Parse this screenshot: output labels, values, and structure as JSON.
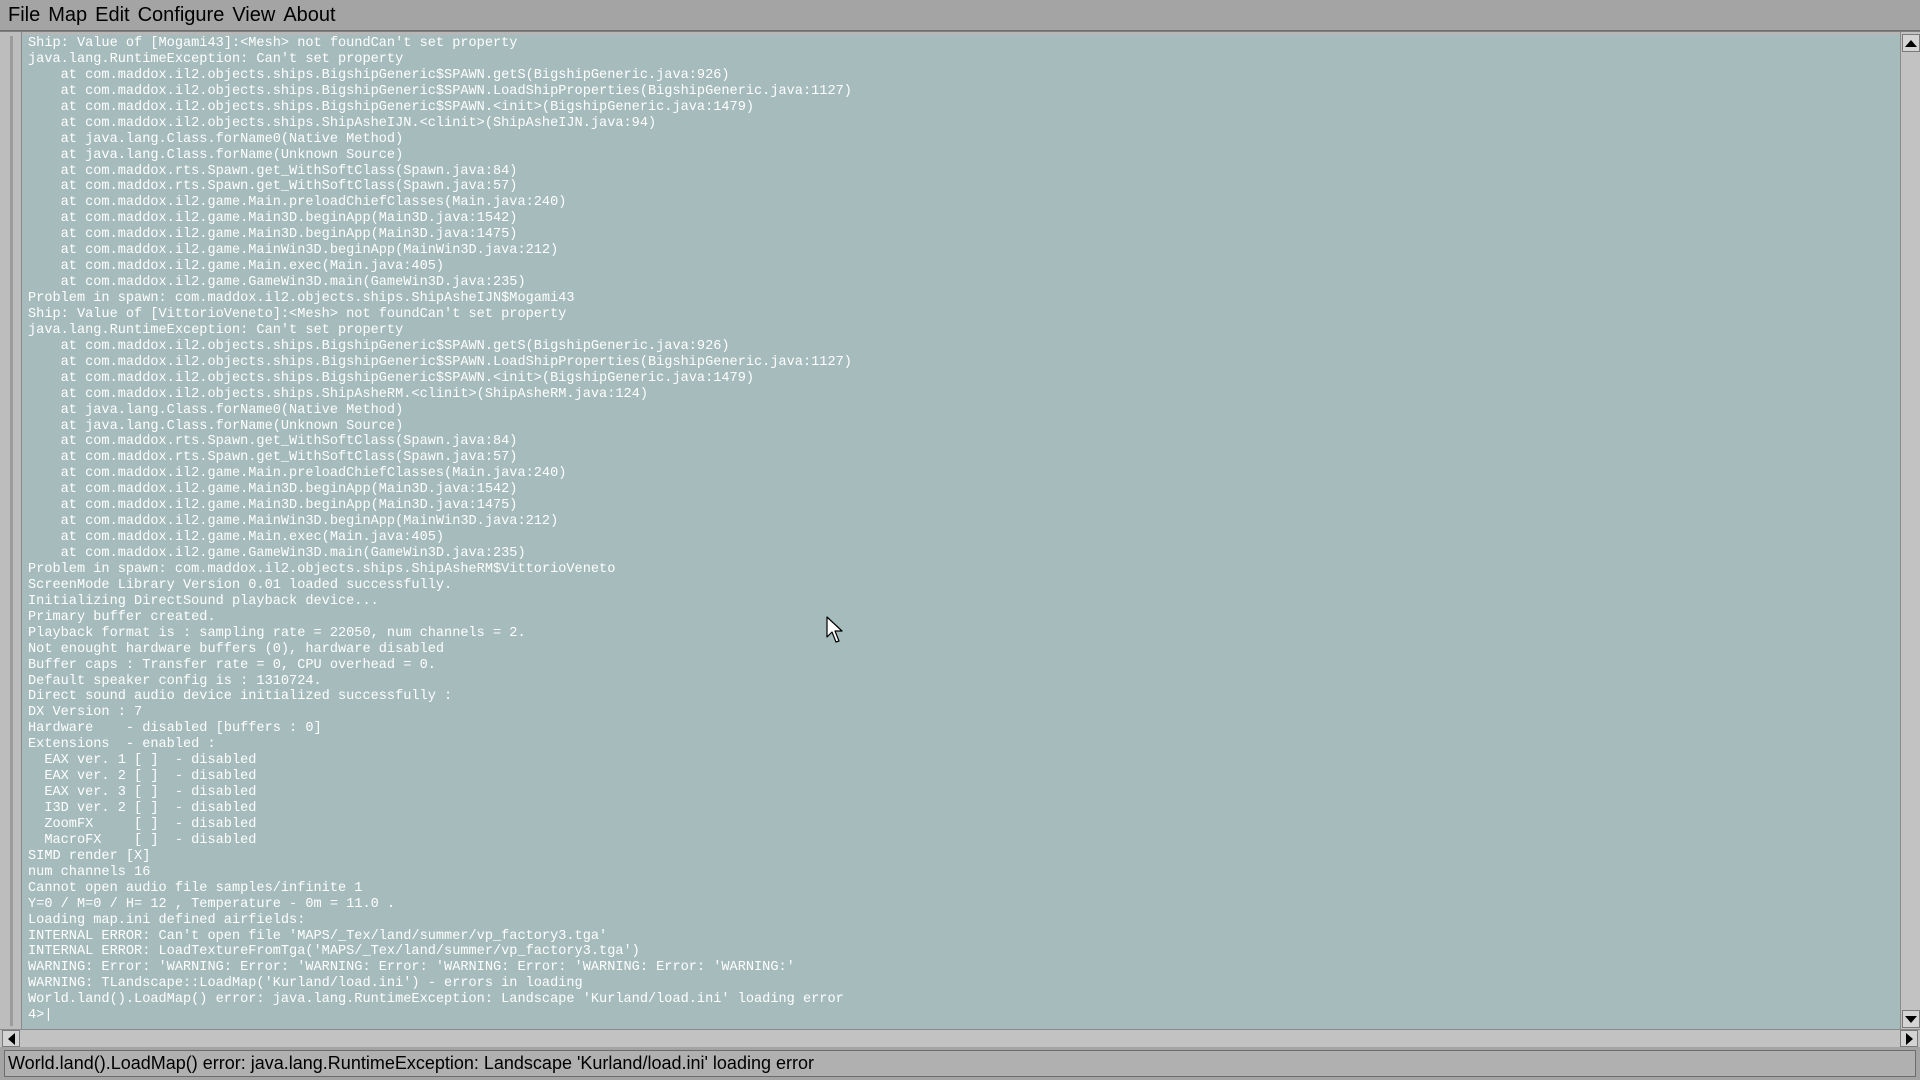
{
  "menubar": {
    "items": [
      "File",
      "Map",
      "Edit",
      "Configure",
      "View",
      "About"
    ]
  },
  "console": {
    "lines": [
      "Ship: Value of [Mogami43]:<Mesh> not foundCan't set property",
      "java.lang.RuntimeException: Can't set property",
      "    at com.maddox.il2.objects.ships.BigshipGeneric$SPAWN.getS(BigshipGeneric.java:926)",
      "    at com.maddox.il2.objects.ships.BigshipGeneric$SPAWN.LoadShipProperties(BigshipGeneric.java:1127)",
      "    at com.maddox.il2.objects.ships.BigshipGeneric$SPAWN.<init>(BigshipGeneric.java:1479)",
      "    at com.maddox.il2.objects.ships.ShipAsheIJN.<clinit>(ShipAsheIJN.java:94)",
      "    at java.lang.Class.forName0(Native Method)",
      "    at java.lang.Class.forName(Unknown Source)",
      "    at com.maddox.rts.Spawn.get_WithSoftClass(Spawn.java:84)",
      "    at com.maddox.rts.Spawn.get_WithSoftClass(Spawn.java:57)",
      "    at com.maddox.il2.game.Main.preloadChiefClasses(Main.java:240)",
      "    at com.maddox.il2.game.Main3D.beginApp(Main3D.java:1542)",
      "    at com.maddox.il2.game.Main3D.beginApp(Main3D.java:1475)",
      "    at com.maddox.il2.game.MainWin3D.beginApp(MainWin3D.java:212)",
      "    at com.maddox.il2.game.Main.exec(Main.java:405)",
      "    at com.maddox.il2.game.GameWin3D.main(GameWin3D.java:235)",
      "Problem in spawn: com.maddox.il2.objects.ships.ShipAsheIJN$Mogami43",
      "Ship: Value of [VittorioVeneto]:<Mesh> not foundCan't set property",
      "java.lang.RuntimeException: Can't set property",
      "    at com.maddox.il2.objects.ships.BigshipGeneric$SPAWN.getS(BigshipGeneric.java:926)",
      "    at com.maddox.il2.objects.ships.BigshipGeneric$SPAWN.LoadShipProperties(BigshipGeneric.java:1127)",
      "    at com.maddox.il2.objects.ships.BigshipGeneric$SPAWN.<init>(BigshipGeneric.java:1479)",
      "    at com.maddox.il2.objects.ships.ShipAsheRM.<clinit>(ShipAsheRM.java:124)",
      "    at java.lang.Class.forName0(Native Method)",
      "    at java.lang.Class.forName(Unknown Source)",
      "    at com.maddox.rts.Spawn.get_WithSoftClass(Spawn.java:84)",
      "    at com.maddox.rts.Spawn.get_WithSoftClass(Spawn.java:57)",
      "    at com.maddox.il2.game.Main.preloadChiefClasses(Main.java:240)",
      "    at com.maddox.il2.game.Main3D.beginApp(Main3D.java:1542)",
      "    at com.maddox.il2.game.Main3D.beginApp(Main3D.java:1475)",
      "    at com.maddox.il2.game.MainWin3D.beginApp(MainWin3D.java:212)",
      "    at com.maddox.il2.game.Main.exec(Main.java:405)",
      "    at com.maddox.il2.game.GameWin3D.main(GameWin3D.java:235)",
      "Problem in spawn: com.maddox.il2.objects.ships.ShipAsheRM$VittorioVeneto",
      "ScreenMode Library Version 0.01 loaded successfully.",
      "Initializing DirectSound playback device...",
      "Primary buffer created.",
      "Playback format is : sampling rate = 22050, num channels = 2.",
      "Not enought hardware buffers (0), hardware disabled",
      "Buffer caps : Transfer rate = 0, CPU overhead = 0.",
      "Default speaker config is : 1310724.",
      "Direct sound audio device initialized successfully :",
      "DX Version : 7",
      "Hardware    - disabled [buffers : 0]",
      "Extensions  - enabled :",
      "  EAX ver. 1 [ ]  - disabled",
      "  EAX ver. 2 [ ]  - disabled",
      "  EAX ver. 3 [ ]  - disabled",
      "  I3D ver. 2 [ ]  - disabled",
      "  ZoomFX     [ ]  - disabled",
      "  MacroFX    [ ]  - disabled",
      "SIMD render [X]",
      "num channels 16",
      "Cannot open audio file samples/infinite 1",
      "Y=0 / M=0 / H= 12 , Temperature - 0m = 11.0 .",
      "Loading map.ini defined airfields:",
      "INTERNAL ERROR: Can't open file 'MAPS/_Tex/land/summer/vp_factory3.tga'",
      "INTERNAL ERROR: LoadTextureFromTga('MAPS/_Tex/land/summer/vp_factory3.tga')",
      "WARNING: Error: 'WARNING: Error: 'WARNING: Error: 'WARNING: Error: 'WARNING: Error: 'WARNING:'",
      "WARNING: TLandscape::LoadMap('Kurland/load.ini') - errors in loading",
      "World.land().LoadMap() error: java.lang.RuntimeException: Landscape 'Kurland/load.ini' loading error",
      "4>|"
    ]
  },
  "statusbar": {
    "text": "World.land().LoadMap() error: java.lang.RuntimeException: Landscape 'Kurland/load.ini' loading error"
  },
  "colors": {
    "console_bg": "#a5bbbc",
    "console_text": "#ffffff",
    "chrome": "#a4a4a4"
  }
}
